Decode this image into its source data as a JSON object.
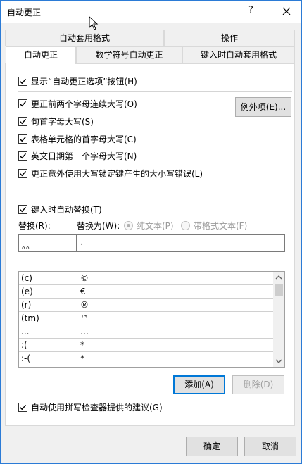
{
  "window": {
    "title": "自动更正",
    "help_label": "?"
  },
  "tabs": {
    "row1": [
      {
        "label": "自动套用格式"
      },
      {
        "label": "操作"
      }
    ],
    "row2": [
      {
        "label": "自动更正"
      },
      {
        "label": "数学符号自动更正"
      },
      {
        "label": "键入时自动套用格式"
      }
    ]
  },
  "options": {
    "show_buttons": {
      "label": "显示“自动更正选项”按钮(H)",
      "checked": true
    },
    "two_initial_caps": {
      "label": "更正前两个字母连续大写(O)",
      "checked": true
    },
    "capitalize_sentences": {
      "label": "句首字母大写(S)",
      "checked": true
    },
    "capitalize_table_cells": {
      "label": "表格单元格的首字母大写(C)",
      "checked": true
    },
    "capitalize_days": {
      "label": "英文日期第一个字母大写(N)",
      "checked": true
    },
    "caps_lock": {
      "label": "更正意外使用大写锁定键产生的大小写错误(L)",
      "checked": true
    }
  },
  "exceptions_button": {
    "label": "例外项(E)..."
  },
  "replace_as_you_type": {
    "label": "键入时自动替换(T)",
    "checked": true
  },
  "replace_label": "替换(R):",
  "with_label": "替换为(W):",
  "radio_plain": {
    "label": "纯文本(P)",
    "selected": true
  },
  "radio_formatted": {
    "label": "带格式文本(F)",
    "selected": false
  },
  "replace_input": {
    "value": "。。"
  },
  "with_input": {
    "value": "·"
  },
  "entries": [
    {
      "replace": "(c)",
      "with": "©"
    },
    {
      "replace": "(e)",
      "with": "€"
    },
    {
      "replace": "(r)",
      "with": "®"
    },
    {
      "replace": "(tm)",
      "with": "™"
    },
    {
      "replace": "...",
      "with": "…"
    },
    {
      "replace": ":(",
      "with": "*"
    },
    {
      "replace": ":-(",
      "with": "*"
    }
  ],
  "add_button": {
    "label": "添加(A)"
  },
  "delete_button": {
    "label": "删除(D)"
  },
  "spellcheck": {
    "label": "自动使用拼写检查器提供的建议(G)",
    "checked": true
  },
  "ok_button": {
    "label": "确定"
  },
  "cancel_button": {
    "label": "取消"
  },
  "colors": {
    "accent": "#0078d7",
    "window_border": "#2b7bd6"
  }
}
